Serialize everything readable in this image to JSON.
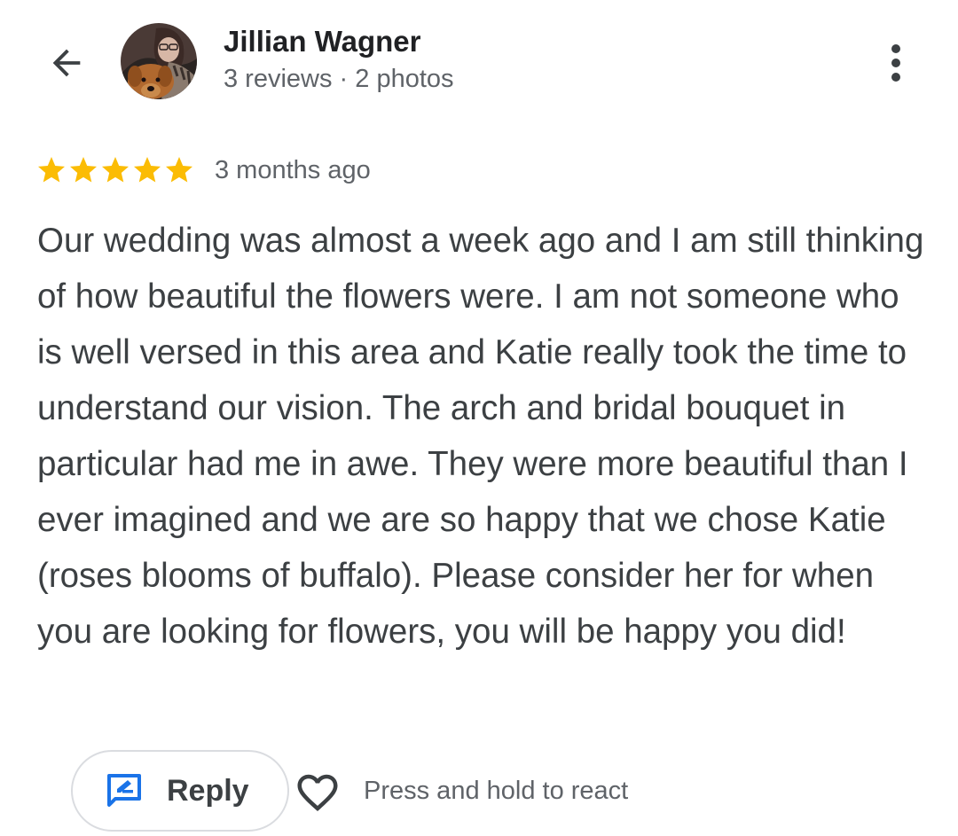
{
  "header": {
    "back_icon": "arrow-back-icon",
    "author_name": "Jillian Wagner",
    "author_meta": "3 reviews · 2 photos",
    "more_icon": "more-vert-icon"
  },
  "review": {
    "rating": 5,
    "max_rating": 5,
    "date": "3 months ago",
    "text": "Our wedding was almost a week ago and I am still thinking of how beautiful the flowers were. I am not someone who is well versed in this area and Katie really took the time to understand our vision. The arch and bridal bouquet in particular had me in awe. They were more beautiful than I ever imagined and we are so happy that we chose Katie (roses blooms of buffalo). Please consider her for when you are looking for flowers, you will be happy you did!"
  },
  "actions": {
    "reply_label": "Reply",
    "reply_icon": "rate-review-icon",
    "react_icon": "heart-outline-icon",
    "react_hint": "Press and hold to react"
  },
  "colors": {
    "star": "#fbbc04",
    "accent": "#1a73e8",
    "primary_text": "#202124",
    "secondary_text": "#5f6368"
  }
}
